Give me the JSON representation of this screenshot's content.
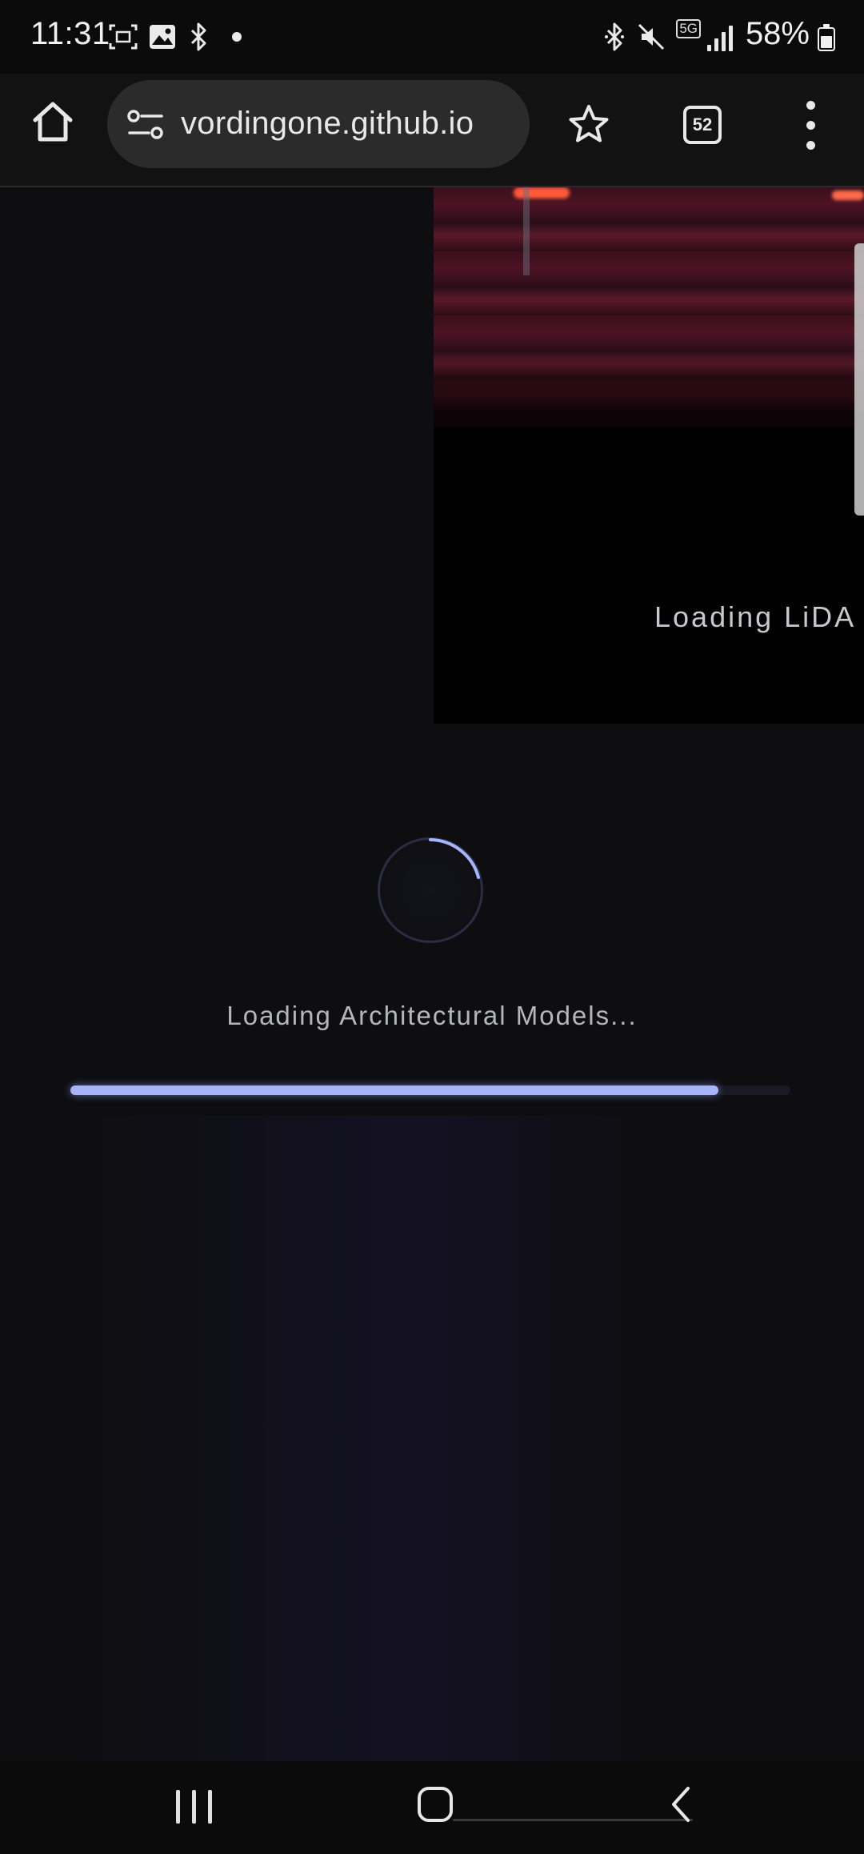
{
  "status_bar": {
    "time": "11:31",
    "network": "5G",
    "battery": "58%",
    "icons": [
      "screen-capture-icon",
      "gallery-icon",
      "bluetooth-icon",
      "notification-dot-icon",
      "bluetooth-icon",
      "mute-icon",
      "signal-icon",
      "battery-icon"
    ]
  },
  "browser": {
    "url": "vordingone.github.io",
    "tab_count": "52"
  },
  "page": {
    "video_overlay_text": "Loading LiDA",
    "loading_text": "Loading Architectural Models...",
    "progress": 0.9,
    "accent_color": "#a8b4f8"
  },
  "colors": {
    "background": "#0e0e11",
    "toolbar": "#121212",
    "urlbar": "#2b2b2b"
  }
}
